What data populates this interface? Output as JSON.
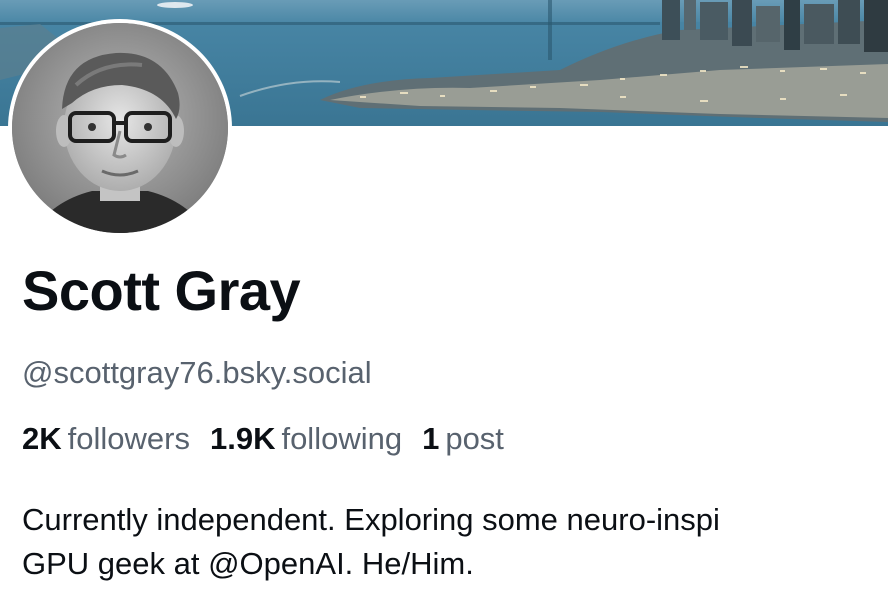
{
  "profile": {
    "display_name": "Scott Gray",
    "handle": "@scottgray76.bsky.social",
    "stats": {
      "followers_count": "2K",
      "followers_label": "followers",
      "following_count": "1.9K",
      "following_label": "following",
      "posts_count": "1",
      "posts_label": "post"
    },
    "bio_lines": [
      "Currently independent.  Exploring some neuro-inspi",
      "GPU geek at @OpenAI.  He/Him."
    ]
  },
  "colors": {
    "banner_water": "#3f7e9e",
    "banner_sky": "#6f9fb8",
    "muted_text": "#58626e",
    "primary_text": "#0b0f14"
  }
}
